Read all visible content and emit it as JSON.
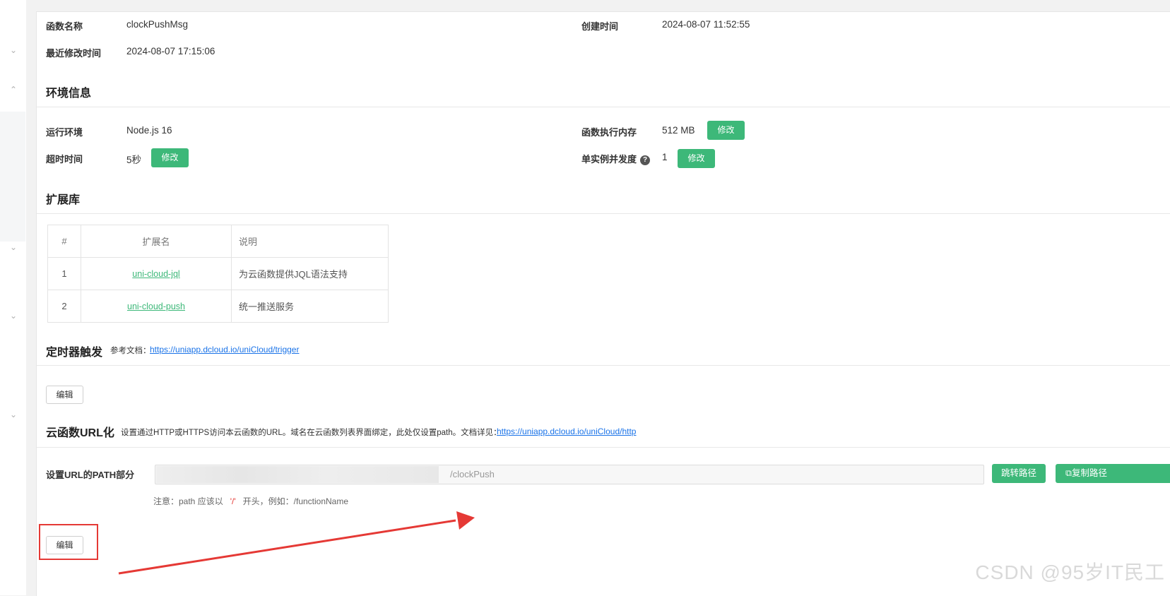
{
  "basic": {
    "name_label": "函数名称",
    "name_value": "clockPushMsg",
    "created_label": "创建时间",
    "created_value": "2024-08-07 11:52:55",
    "modified_label": "最近修改时间",
    "modified_value": "2024-08-07 17:15:06"
  },
  "env": {
    "title": "环境信息",
    "runtime_label": "运行环境",
    "runtime_value": "Node.js 16",
    "memory_label": "函数执行内存",
    "memory_value": "512 MB",
    "timeout_label": "超时时间",
    "timeout_value": "5秒",
    "concurrency_label": "单实例并发度",
    "concurrency_value": "1",
    "modify_label": "修改",
    "help_icon": "?"
  },
  "extensions": {
    "title": "扩展库",
    "columns": [
      "#",
      "扩展名",
      "说明"
    ],
    "rows": [
      {
        "index": "1",
        "name": "uni-cloud-jql",
        "desc": "为云函数提供JQL语法支持"
      },
      {
        "index": "2",
        "name": "uni-cloud-push",
        "desc": "统一推送服务"
      }
    ]
  },
  "trigger": {
    "title": "定时器触发",
    "ref_label": "参考文档：",
    "ref_link": "https://uniapp.dcloud.io/uniCloud/trigger",
    "edit_label": "编辑"
  },
  "url": {
    "title": "云函数URL化",
    "desc": "设置通过HTTP或HTTPS访问本云函数的URL。域名在云函数列表界面绑定，此处仅设置path。文档详见：",
    "doc_link": "https://uniapp.dcloud.io/uniCloud/http",
    "path_label": "设置URL的PATH部分",
    "path_suffix": "/clockPush",
    "jump_label": "跳转路径",
    "copy_label": "复制路径",
    "copy_icon": "copy-icon",
    "note_prefix": "注意：path 应该以",
    "note_slash": "'/'",
    "note_suffix": "开头，例如：/functionName",
    "edit_label": "编辑"
  },
  "watermark": "CSDN @95岁IT民工",
  "colors": {
    "accent": "#3db879",
    "link": "#1a73e8",
    "highlight": "#e53935"
  }
}
